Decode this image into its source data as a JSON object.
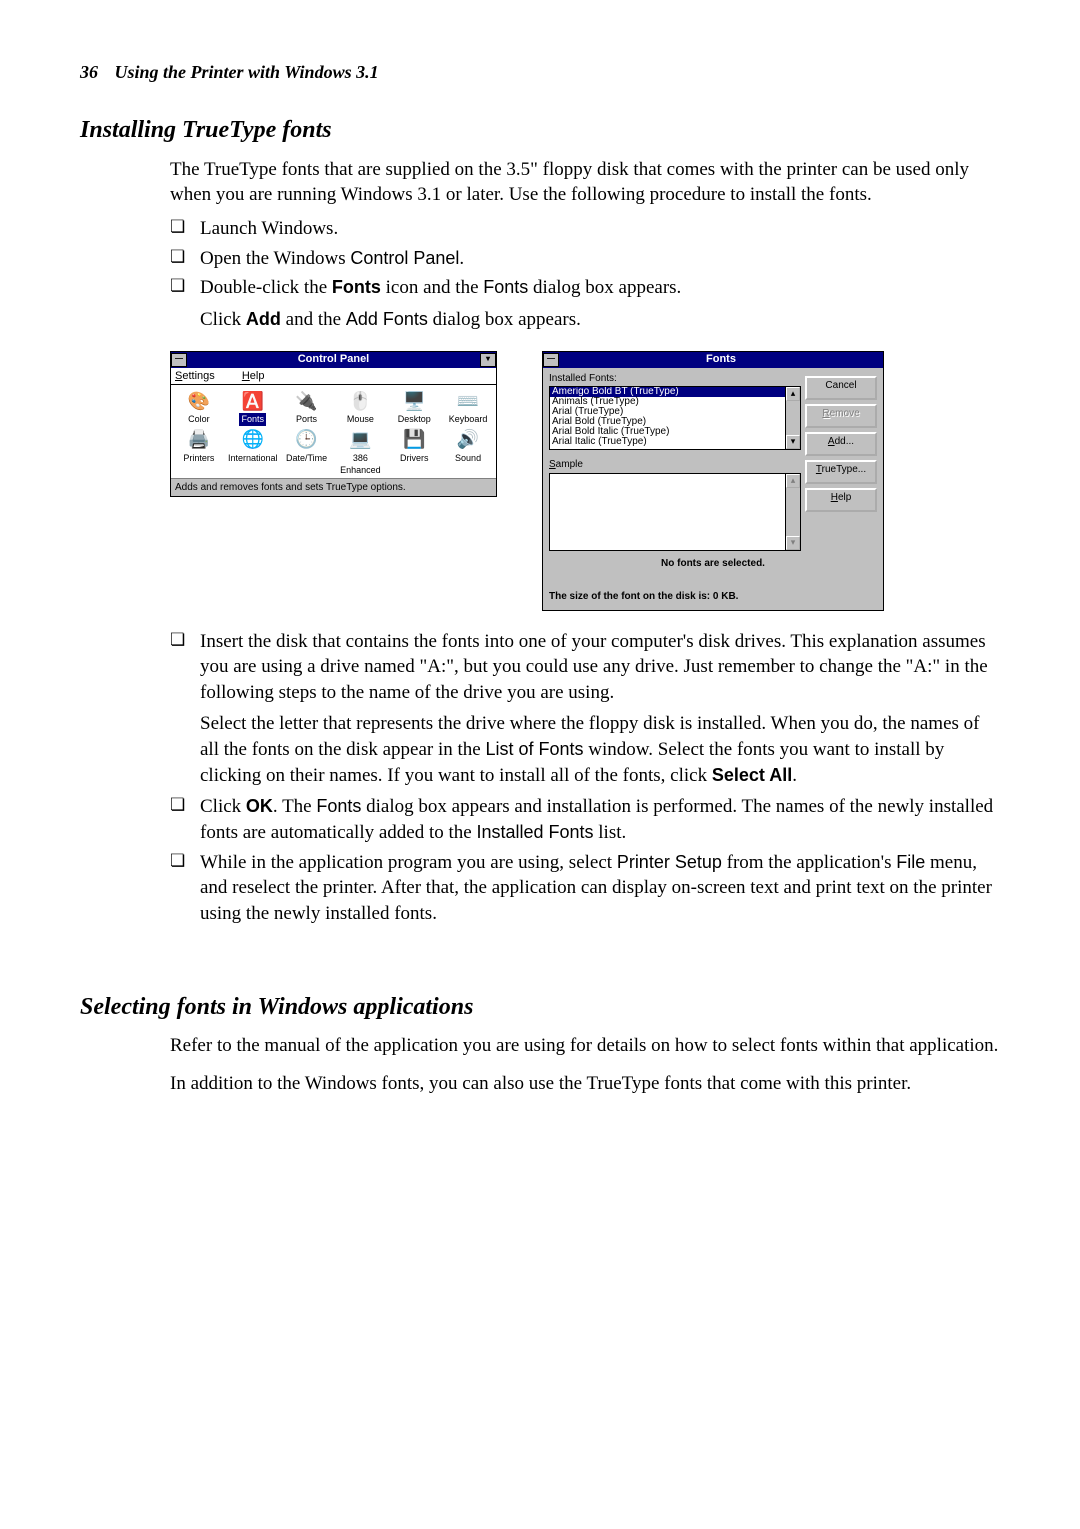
{
  "header": {
    "page_number": "36",
    "running_title": "Using the Printer with Windows 3.1"
  },
  "section1": {
    "title": "Installing TrueType fonts",
    "intro": "The TrueType fonts that are supplied on the 3.5\" floppy disk that comes with the printer can be used only when you are running Windows 3.1 or later. Use the following procedure to install the fonts.",
    "steps_a": {
      "s1": "Launch Windows.",
      "s2_pre": "Open the Windows ",
      "s2_cp": "Control Panel",
      "s2_post": ".",
      "s3_pre": "Double-click the ",
      "s3_fonts_bold": "Fonts",
      "s3_mid": " icon and the ",
      "s3_fonts_sans": "Fonts",
      "s3_post": " dialog box appears.",
      "s3b_pre": "Click ",
      "s3b_add_bold": "Add",
      "s3b_mid": " and the ",
      "s3b_add_sans": "Add Fonts",
      "s3b_post": " dialog box appears."
    },
    "cp": {
      "title": "Control Panel",
      "menu_settings": "Settings",
      "menu_help": "Help",
      "icons": {
        "color": "Color",
        "fonts": "Fonts",
        "ports": "Ports",
        "mouse": "Mouse",
        "desktop": "Desktop",
        "keyboard": "Keyboard",
        "printers": "Printers",
        "international": "International",
        "datetime": "Date/Time",
        "enhanced": "386 Enhanced",
        "drivers": "Drivers",
        "sound": "Sound"
      },
      "status": "Adds and removes fonts and sets TrueType options."
    },
    "fd": {
      "title": "Fonts",
      "installed_label": "Installed Fonts:",
      "list": [
        "Amerigo Bold BT (TrueType)",
        "Animals (TrueType)",
        "Arial (TrueType)",
        "Arial Bold (TrueType)",
        "Arial Bold Italic (TrueType)",
        "Arial Italic (TrueType)"
      ],
      "btn_cancel": "Cancel",
      "btn_remove": "Remove",
      "btn_add": "Add...",
      "btn_truetype": "TrueType...",
      "btn_help": "Help",
      "sample_label": "Sample",
      "no_fonts": "No fonts are selected.",
      "size_line": "The size of the font on the disk is:  0 KB."
    },
    "steps_b": {
      "s4a": "Insert the disk that contains the fonts into one of your computer's disk drives. This explanation assumes you are using a drive named \"A:\", but you could use any drive. Just remember to change the \"A:\" in the following steps to the name of the drive you are using.",
      "s4b_pre": "Select the letter that represents the drive where the floppy disk is installed. When you do, the names of all the fonts on the disk appear in the ",
      "s4b_listof": "List of Fonts",
      "s4b_mid": " window. Select the fonts you want to install by clicking on their names. If you want to install all of the fonts, click ",
      "s4b_selectall": "Select All",
      "s4b_post": ".",
      "s5_pre": "Click ",
      "s5_ok": "OK",
      "s5_mid1": ". The ",
      "s5_fonts": "Fonts",
      "s5_mid2": " dialog box appears and installation is performed. The names of the newly installed fonts are automatically added to the ",
      "s5_installed": "Installed Fonts",
      "s5_post": " list.",
      "s6_pre": "While in the application program you are using, select ",
      "s6_ps": "Printer Setup",
      "s6_mid1": " from the application's ",
      "s6_file": "File",
      "s6_post": " menu, and reselect the printer. After that, the application can display on-screen text and print text on the printer using the newly installed fonts."
    }
  },
  "section2": {
    "title": "Selecting fonts in Windows applications",
    "p1": "Refer to the manual of the application you are using for details on how to select fonts within that application.",
    "p2": "In addition to the Windows fonts, you can also use the TrueType fonts that come with this printer."
  }
}
